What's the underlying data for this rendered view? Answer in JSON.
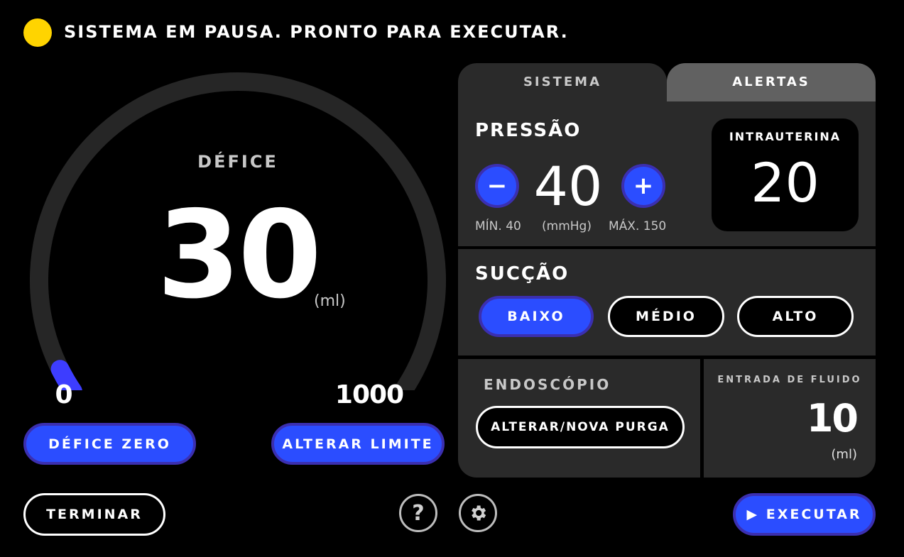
{
  "status": {
    "text": "SISTEMA EM PAUSA. PRONTO PARA EXECUTAR.",
    "indicator_color": "#ffd400"
  },
  "gauge": {
    "title": "DÉFICE",
    "value": "30",
    "unit": "(ml)",
    "min_label": "0",
    "max_label": "1000",
    "level_fraction": 0.03,
    "track_color": "#262626",
    "fill_color": "#3d3dff"
  },
  "buttons": {
    "zero_deficit": "DÉFICE ZERO",
    "change_limit": "ALTERAR LIMITE",
    "terminate": "TERMINAR",
    "execute": "▶  EXECUTAR",
    "help": "?"
  },
  "icons": {
    "help": "help-icon",
    "settings": "gear-icon",
    "play": "play-icon"
  },
  "tabs": [
    {
      "label": "SISTEMA",
      "active": true
    },
    {
      "label": "ALERTAS",
      "active": false
    }
  ],
  "pressure": {
    "title": "PRESSÃO",
    "value": "40",
    "decrease": "−",
    "increase": "+",
    "min_label": "MÍN. 40",
    "unit_label": "(mmHg)",
    "max_label": "MÁX. 150",
    "intrauterine_label": "INTRAUTERINA",
    "intrauterine_value": "20"
  },
  "suction": {
    "title": "SUCÇÃO",
    "options": [
      "BAIXO",
      "MÉDIO",
      "ALTO"
    ],
    "selected": "BAIXO"
  },
  "endoscope": {
    "title": "ENDOSCÓPIO",
    "button": "ALTERAR/NOVA PURGA"
  },
  "fluid": {
    "title": "ENTRADA DE FLUIDO",
    "value": "10",
    "unit": "(ml)"
  },
  "colors": {
    "accent_blue": "#2b4dff",
    "panel_bg": "#2a2a2a",
    "inactive_tab": "#616161"
  }
}
